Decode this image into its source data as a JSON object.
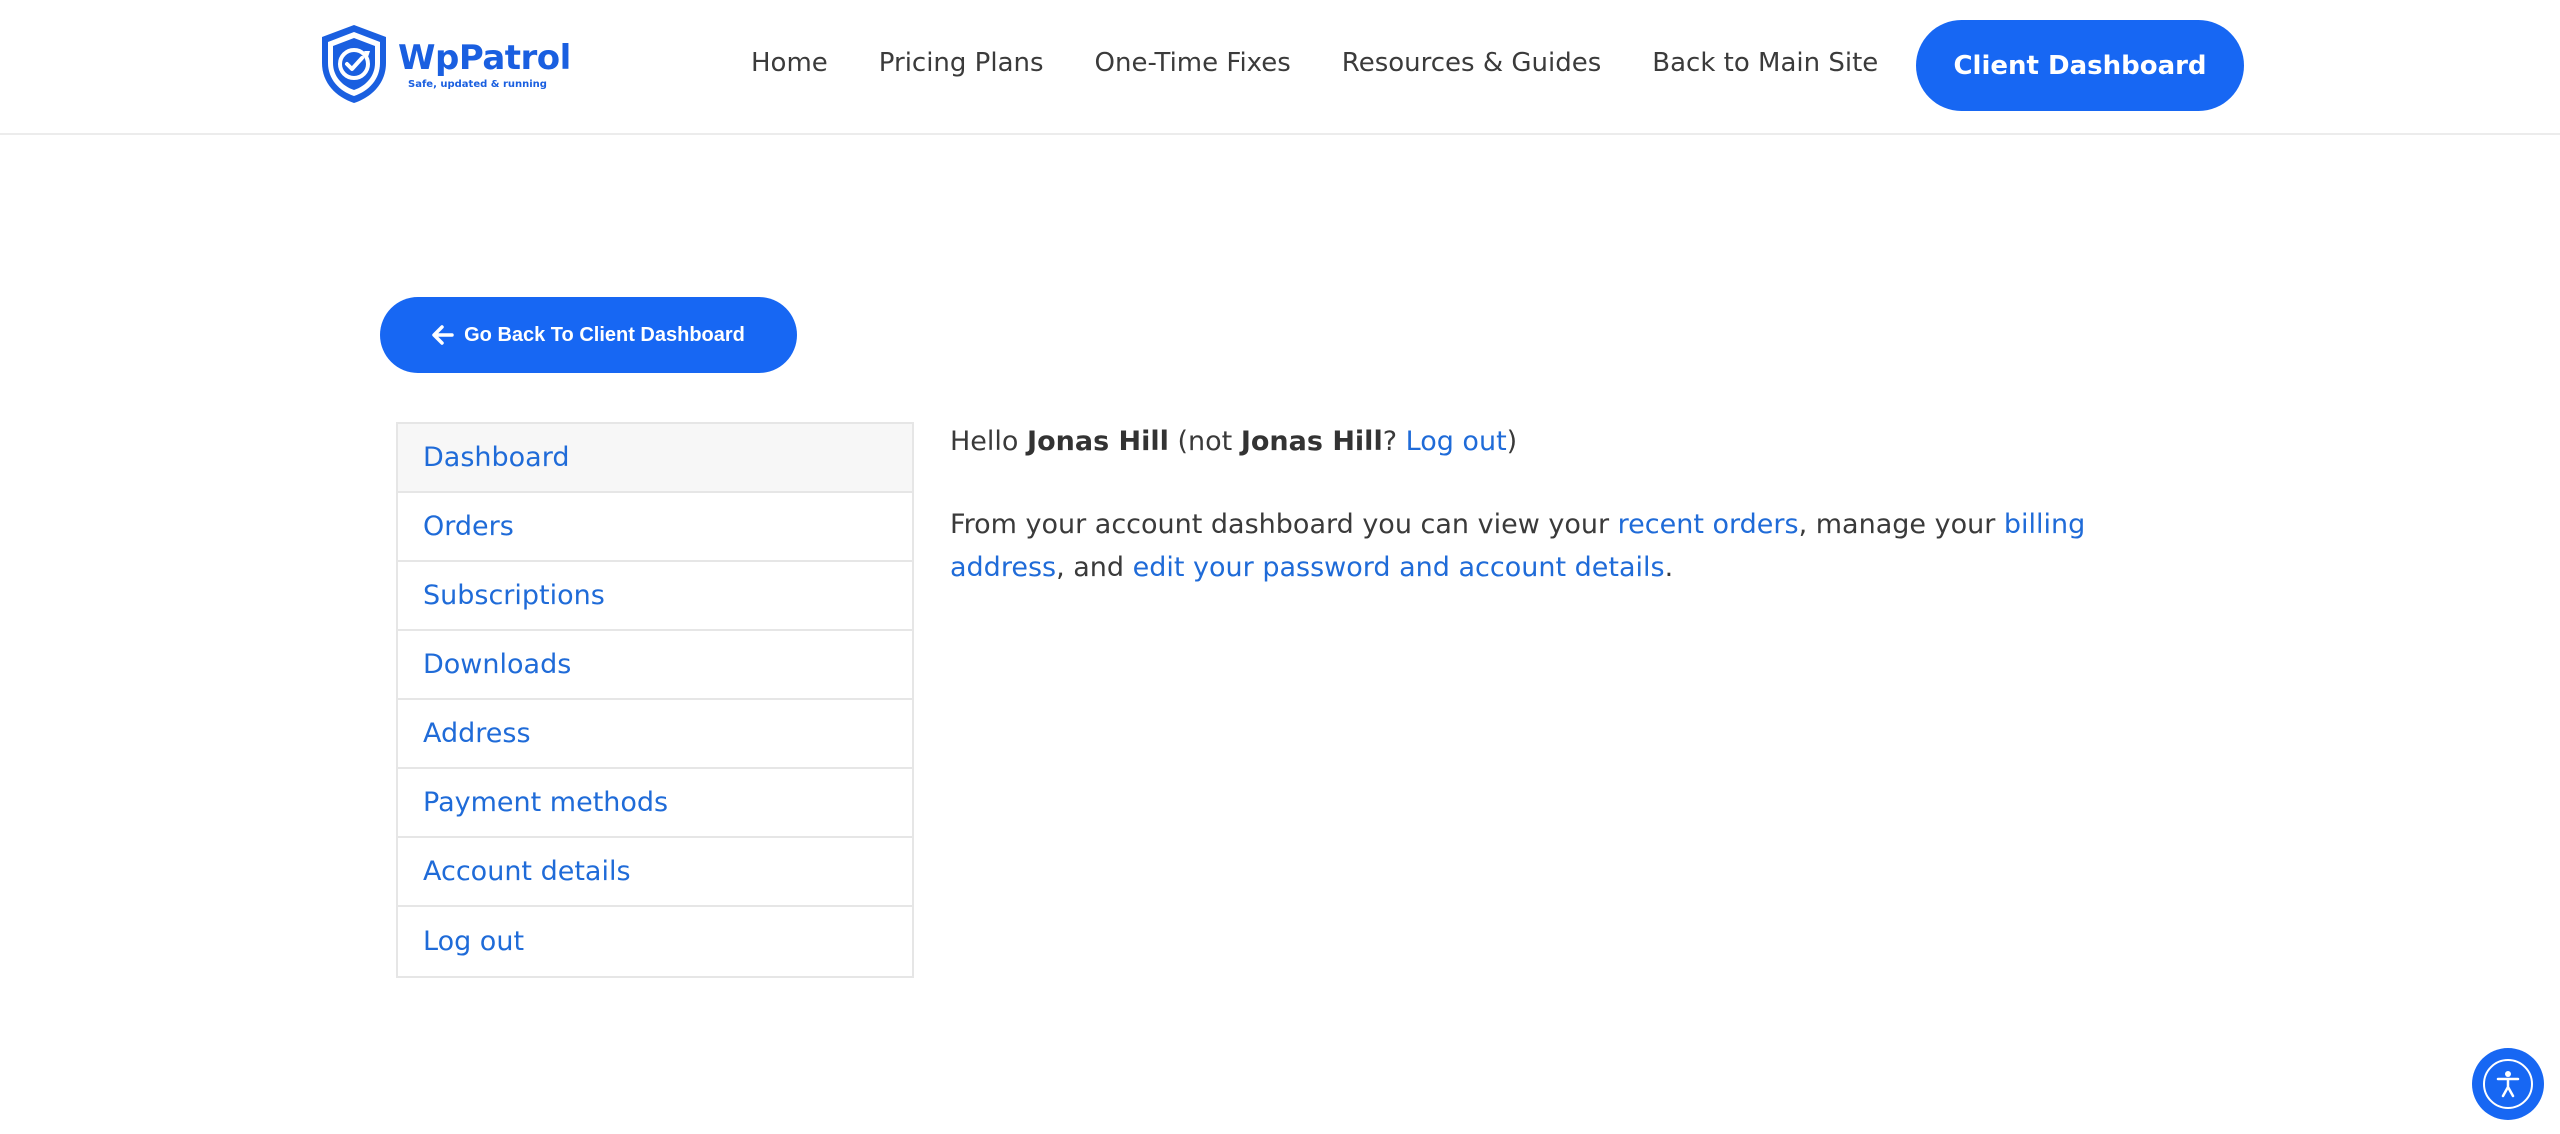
{
  "header": {
    "logo": {
      "name": "WpPatrol",
      "tagline": "Safe, updated & running"
    },
    "nav": [
      "Home",
      "Pricing Plans",
      "One-Time Fixes",
      "Resources & Guides",
      "Back to Main Site"
    ],
    "cta_label": "Client Dashboard"
  },
  "back_button": {
    "label": "Go Back To Client Dashboard",
    "icon": "arrow-left-icon"
  },
  "account_nav": {
    "items": [
      "Dashboard",
      "Orders",
      "Subscriptions",
      "Downloads",
      "Address",
      "Payment methods",
      "Account details",
      "Log out"
    ],
    "active": "Dashboard"
  },
  "content": {
    "hello_prefix": "Hello ",
    "user_name": "Jonas Hill",
    "not_prefix": " (not ",
    "not_name": "Jonas Hill",
    "question": "? ",
    "logout_link": "Log out",
    "close_paren": ")",
    "desc_1": "From your account dashboard you can view your ",
    "recent_orders_link": "recent orders",
    "desc_2": ", manage your ",
    "billing_address_link": "billing address",
    "desc_3": ", and ",
    "edit_link": "edit your password and account details",
    "desc_4": "."
  },
  "accessibility_button": {
    "icon": "accessibility-icon"
  },
  "colors": {
    "accent": "#1767f3",
    "link": "#1f6bd8",
    "text": "#3a3a3a"
  }
}
